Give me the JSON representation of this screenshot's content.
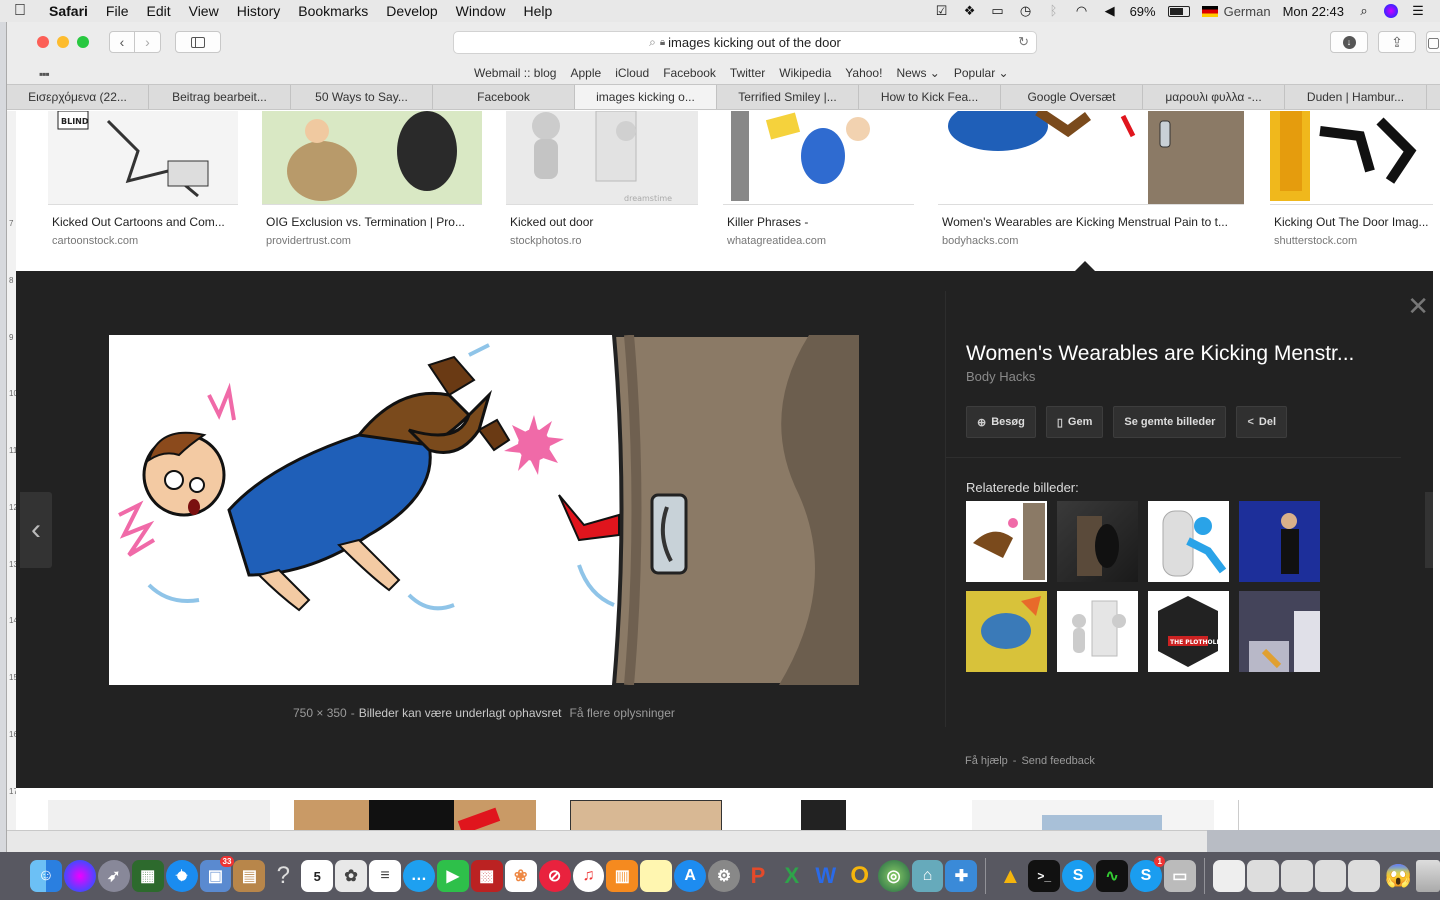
{
  "menubar": {
    "app": "Safari",
    "items": [
      "File",
      "Edit",
      "View",
      "History",
      "Bookmarks",
      "Develop",
      "Window",
      "Help"
    ],
    "battery": "69%",
    "input_language": "German",
    "clock": "Mon 22:43"
  },
  "toolbar": {
    "url_text": "images kicking out of the door"
  },
  "favorites": [
    "Webmail :: blog",
    "Apple",
    "iCloud",
    "Facebook",
    "Twitter",
    "Wikipedia",
    "Yahoo!",
    "News ⌄",
    "Popular ⌄"
  ],
  "tabs": [
    {
      "label": "Εισερχόμενα (22...",
      "active": false
    },
    {
      "label": "Beitrag bearbeit...",
      "active": false
    },
    {
      "label": "50 Ways to Say...",
      "active": false
    },
    {
      "label": "Facebook",
      "active": false
    },
    {
      "label": "images kicking o...",
      "active": true
    },
    {
      "label": "Terrified Smiley |...",
      "active": false
    },
    {
      "label": "How to Kick Fea...",
      "active": false
    },
    {
      "label": "Google Oversæt",
      "active": false
    },
    {
      "label": "μαρουλι φυλλα -...",
      "active": false
    },
    {
      "label": "Duden | Hambur...",
      "active": false
    }
  ],
  "results": [
    {
      "title": "Kicked Out Cartoons and Com...",
      "source": "cartoonstock.com"
    },
    {
      "title": "OIG Exclusion vs. Termination | Pro...",
      "source": "providertrust.com"
    },
    {
      "title": "Kicked out door",
      "source": "stockphotos.ro"
    },
    {
      "title": "Killer Phrases -",
      "source": "whatagreatidea.com"
    },
    {
      "title": "Women's Wearables are Kicking Menstrual Pain to t...",
      "source": "bodyhacks.com"
    },
    {
      "title": "Kicking Out The Door Imag...",
      "source": "shutterstock.com"
    }
  ],
  "preview": {
    "title": "Women's Wearables are Kicking Menstr...",
    "source": "Body Hacks",
    "dimensions": "750 × 350",
    "copyright_link": "Billeder kan være underlagt ophavsret",
    "more_info": "Få flere oplysninger",
    "actions": [
      {
        "icon": "globe-icon",
        "glyph": "⊕",
        "label": "Besøg"
      },
      {
        "icon": "bookmark-icon",
        "glyph": "▯",
        "label": "Gem"
      },
      {
        "icon": "",
        "glyph": "",
        "label": "Se gemte billeder"
      },
      {
        "icon": "share-icon",
        "glyph": "<",
        "label": "Del"
      }
    ],
    "related_label": "Relaterede billeder:",
    "footer_help": "Få hjælp",
    "footer_feedback": "Send feedback"
  },
  "colors": {
    "preview_bg": "#222222",
    "page_bg": "#ffffff",
    "shirt_blue": "#1f5fb8",
    "pants_brown": "#7a4a1c",
    "door_brown": "#8b7a66",
    "kick_red": "#e0151d",
    "burst_pink": "#f06aa8"
  }
}
